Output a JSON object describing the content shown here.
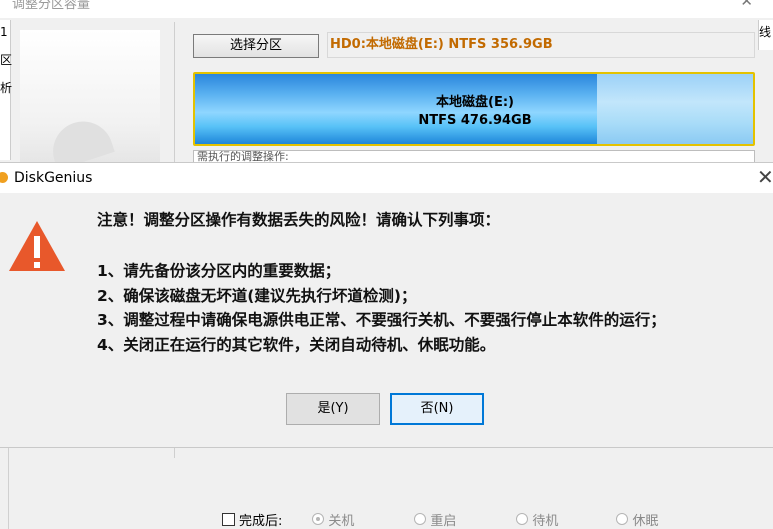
{
  "background_window": {
    "title": "调整分区容量",
    "left_strip_chars": [
      "1",
      "区",
      "析"
    ],
    "right_strip_char": "线",
    "select_partition_button": "选择分区",
    "partition_info": "HD0:本地磁盘(E:) NTFS 356.9GB",
    "disk_bar": {
      "name": "本地磁盘(E:)",
      "info": "NTFS 476.94GB",
      "used_fraction": 0.72
    },
    "pending_ops_label": "需执行的调整操作:",
    "after_complete": {
      "label": "完成后:",
      "options": [
        "关机",
        "重启",
        "待机",
        "休眠"
      ],
      "selected": "关机"
    }
  },
  "dialog": {
    "title": "DiskGenius",
    "heading": "注意！调整分区操作有数据丢失的风险！请确认下列事项：",
    "items": [
      "1、请先备份该分区内的重要数据；",
      "2、确保该磁盘无坏道(建议先执行坏道检测)；",
      "3、调整过程中请确保电源供电正常、不要强行关机、不要强行停止本软件的运行；",
      "4、关闭正在运行的其它软件，关闭自动待机、休眠功能。"
    ],
    "yes_button": "是(Y)",
    "no_button": "否(N)"
  },
  "colors": {
    "warning": "#e8582b",
    "partition_info_text": "#c26a00",
    "default_button_border": "#0078d7"
  },
  "icons": {
    "warning": "warning-triangle-icon",
    "close": "close-icon",
    "app": "diskgenius-app-icon"
  }
}
